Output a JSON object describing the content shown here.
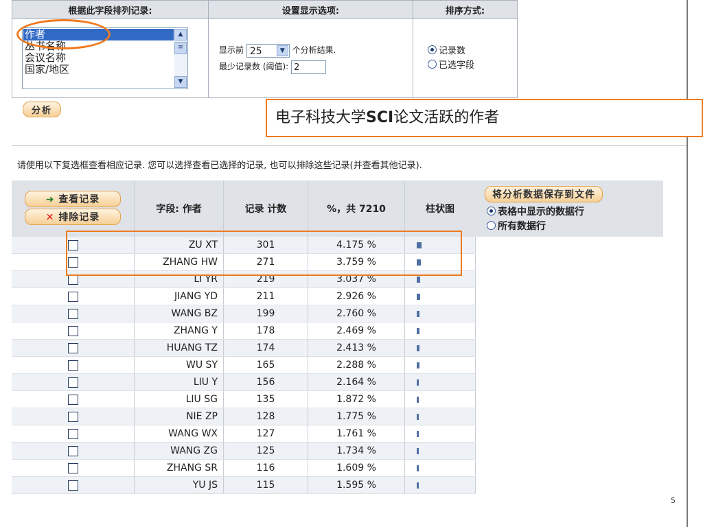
{
  "options_panel": {
    "sort_field_header": "根据此字段排列记录:",
    "display_options_header": "设置显示选项:",
    "sort_order_header": "排序方式:",
    "fields": [
      "作者",
      "丛书名称",
      "会议名称",
      "国家/地区"
    ],
    "selected_field": "作者",
    "show_first_prefix": "显示前",
    "show_first_value": "25",
    "show_first_suffix": "个分析结果.",
    "min_records_label": "最少记录数 (阈值):",
    "min_records_value": "2",
    "sort_options": [
      "记录数",
      "已选字段"
    ],
    "sort_selected": "记录数"
  },
  "analyze_button": "分析",
  "callout": {
    "prefix": "电子科技大学",
    "bold": "SCI",
    "suffix": "论文活跃的作者"
  },
  "instruction": "请使用以下复选框查看相应记录. 您可以选择查看已选择的记录, 也可以排除这些记录(并查看其他记录).",
  "results": {
    "view_records_button": "查看记录",
    "exclude_records_button": "排除记录",
    "col_field": "字段: 作者",
    "col_count": "记录 计数",
    "col_percent": "%，共 7210",
    "col_bar": "柱状图",
    "rows": [
      {
        "author": "ZU XT",
        "count": "301",
        "percent": "4.175 %",
        "share": 4.175
      },
      {
        "author": "ZHANG HW",
        "count": "271",
        "percent": "3.759 %",
        "share": 3.759
      },
      {
        "author": "LI YR",
        "count": "219",
        "percent": "3.037 %",
        "share": 3.037
      },
      {
        "author": "JIANG YD",
        "count": "211",
        "percent": "2.926 %",
        "share": 2.926
      },
      {
        "author": "WANG BZ",
        "count": "199",
        "percent": "2.760 %",
        "share": 2.76
      },
      {
        "author": "ZHANG Y",
        "count": "178",
        "percent": "2.469 %",
        "share": 2.469
      },
      {
        "author": "HUANG TZ",
        "count": "174",
        "percent": "2.413 %",
        "share": 2.413
      },
      {
        "author": "WU SY",
        "count": "165",
        "percent": "2.288 %",
        "share": 2.288
      },
      {
        "author": "LIU Y",
        "count": "156",
        "percent": "2.164 %",
        "share": 2.164
      },
      {
        "author": "LIU SG",
        "count": "135",
        "percent": "1.872 %",
        "share": 1.872
      },
      {
        "author": "NIE ZP",
        "count": "128",
        "percent": "1.775 %",
        "share": 1.775
      },
      {
        "author": "WANG WX",
        "count": "127",
        "percent": "1.761 %",
        "share": 1.761
      },
      {
        "author": "WANG ZG",
        "count": "125",
        "percent": "1.734 %",
        "share": 1.734
      },
      {
        "author": "ZHANG SR",
        "count": "116",
        "percent": "1.609 %",
        "share": 1.609
      },
      {
        "author": "YU JS",
        "count": "115",
        "percent": "1.595 %",
        "share": 1.595
      }
    ]
  },
  "save_panel": {
    "button": "将分析数据保存到文件",
    "option_table_rows": "表格中显示的数据行",
    "option_all_rows": "所有数据行",
    "selected": "表格中显示的数据行"
  },
  "page_number": "5",
  "colors": {
    "highlight": "#ee7a1e",
    "bar": "#4e6fa3",
    "header_bg": "#dfe3e8",
    "selection": "#316ac5"
  }
}
